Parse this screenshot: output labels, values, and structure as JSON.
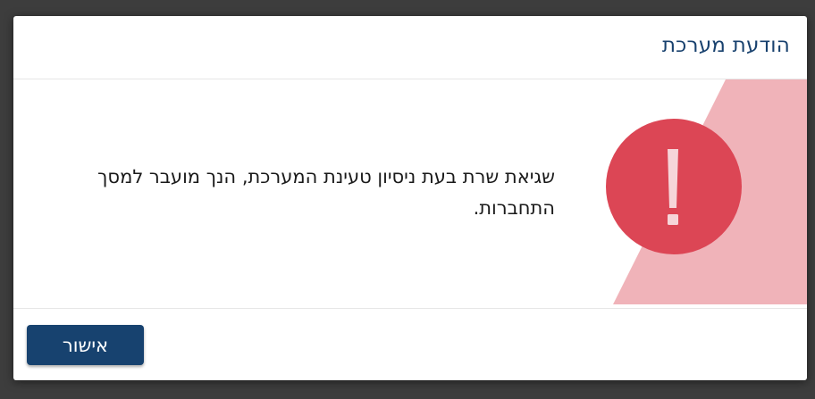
{
  "dialog": {
    "title": "הודעת מערכת",
    "icon": "exclamation-icon",
    "message": "שגיאת שרת בעת ניסיון טעינת המערכת, הנך מועבר למסך התחברות.",
    "ok_label": "אישור"
  },
  "colors": {
    "title": "#18416e",
    "button": "#17426f",
    "alert_circle": "#dc4655",
    "alert_stripe": "#f0b3b9",
    "overlay": "#3d3d3d"
  }
}
